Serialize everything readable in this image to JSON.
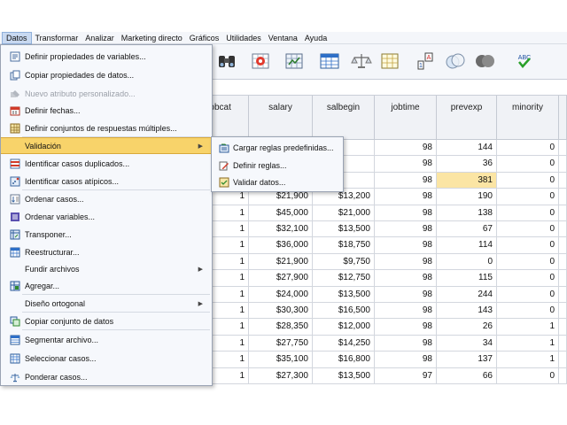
{
  "menubar": {
    "items": [
      {
        "label": "Datos",
        "active": true
      },
      {
        "label": "Transformar"
      },
      {
        "label": "Analizar"
      },
      {
        "label": "Marketing directo"
      },
      {
        "label": "Gráficos"
      },
      {
        "label": "Utilidades"
      },
      {
        "label": "Ventana"
      },
      {
        "label": "Ayuda"
      }
    ]
  },
  "toolbar": {
    "icons": [
      "binoculars-icon",
      "go-to-case-icon",
      "go-to-variable-icon",
      "split-file-icon",
      "weight-cases-icon",
      "select-cases-icon",
      "value-labels-icon",
      "use-sets-icon",
      "show-all-variables-icon",
      "spell-check-icon"
    ],
    "spellcheck_label": "ABC"
  },
  "grid": {
    "columns": [
      "jobcat",
      "salary",
      "salbegin",
      "jobtime",
      "prevexp",
      "minority"
    ],
    "rows": [
      {
        "jobcat": "",
        "salary": "",
        "salbegin": "",
        "jobtime": "98",
        "prevexp": "144",
        "minority": "0"
      },
      {
        "jobcat": "",
        "salary": "",
        "salbegin": "",
        "jobtime": "98",
        "prevexp": "36",
        "minority": "0"
      },
      {
        "jobcat": "",
        "salary": "",
        "salbegin": "",
        "jobtime": "98",
        "prevexp": "381",
        "minority": "0"
      },
      {
        "jobcat": "1",
        "salary": "$21,900",
        "salbegin": "$13,200",
        "jobtime": "98",
        "prevexp": "190",
        "minority": "0"
      },
      {
        "jobcat": "1",
        "salary": "$45,000",
        "salbegin": "$21,000",
        "jobtime": "98",
        "prevexp": "138",
        "minority": "0"
      },
      {
        "jobcat": "1",
        "salary": "$32,100",
        "salbegin": "$13,500",
        "jobtime": "98",
        "prevexp": "67",
        "minority": "0"
      },
      {
        "jobcat": "1",
        "salary": "$36,000",
        "salbegin": "$18,750",
        "jobtime": "98",
        "prevexp": "114",
        "minority": "0"
      },
      {
        "jobcat": "1",
        "salary": "$21,900",
        "salbegin": "$9,750",
        "jobtime": "98",
        "prevexp": "0",
        "minority": "0"
      },
      {
        "jobcat": "1",
        "salary": "$27,900",
        "salbegin": "$12,750",
        "jobtime": "98",
        "prevexp": "115",
        "minority": "0"
      },
      {
        "jobcat": "1",
        "salary": "$24,000",
        "salbegin": "$13,500",
        "jobtime": "98",
        "prevexp": "244",
        "minority": "0"
      },
      {
        "jobcat": "1",
        "salary": "$30,300",
        "salbegin": "$16,500",
        "jobtime": "98",
        "prevexp": "143",
        "minority": "0"
      },
      {
        "jobcat": "1",
        "salary": "$28,350",
        "salbegin": "$12,000",
        "jobtime": "98",
        "prevexp": "26",
        "minority": "1"
      },
      {
        "jobcat": "1",
        "salary": "$27,750",
        "salbegin": "$14,250",
        "jobtime": "98",
        "prevexp": "34",
        "minority": "1"
      },
      {
        "jobcat": "1",
        "salary": "$35,100",
        "salbegin": "$16,800",
        "jobtime": "98",
        "prevexp": "137",
        "minority": "1"
      },
      {
        "jobcat": "1",
        "salary": "$27,300",
        "salbegin": "$13,500",
        "jobtime": "97",
        "prevexp": "66",
        "minority": "0"
      }
    ],
    "highlight_color": "#fbe5a4"
  },
  "data_menu": {
    "items": [
      {
        "label": "Definir propiedades de variables...",
        "icon": "define-properties-icon"
      },
      {
        "label": "Copiar propiedades de datos...",
        "icon": "copy-properties-icon"
      },
      {
        "label": "Nuevo atributo personalizado...",
        "icon": "custom-attribute-icon",
        "disabled": true
      },
      {
        "label": "Definir fechas...",
        "icon": "calendar-icon"
      },
      {
        "label": "Definir conjuntos de respuestas múltiples...",
        "icon": "multiple-response-icon"
      },
      {
        "label": "Validación",
        "submenu": true,
        "selected": true
      },
      {
        "label": "Identificar casos duplicados...",
        "icon": "duplicate-cases-icon"
      },
      {
        "label": "Identificar casos atípicos...",
        "icon": "unusual-cases-icon"
      },
      {
        "label": "Ordenar casos...",
        "icon": "sort-cases-icon"
      },
      {
        "label": "Ordenar variables...",
        "icon": "sort-variables-icon"
      },
      {
        "label": "Transponer...",
        "icon": "transpose-icon"
      },
      {
        "label": "Reestructurar...",
        "icon": "restructure-icon"
      },
      {
        "label": "Fundir archivos",
        "submenu": true
      },
      {
        "label": "Agregar...",
        "icon": "aggregate-icon"
      },
      {
        "label": "Diseño ortogonal",
        "submenu": true
      },
      {
        "label": "Copiar conjunto de datos",
        "icon": "copy-dataset-icon"
      },
      {
        "label": "Segmentar archivo...",
        "icon": "split-file-icon"
      },
      {
        "label": "Seleccionar casos...",
        "icon": "select-cases-icon"
      },
      {
        "label": "Ponderar casos...",
        "icon": "weight-cases-icon"
      }
    ]
  },
  "validation_submenu": {
    "items": [
      {
        "label": "Cargar reglas predefinidas...",
        "icon": "load-rules-icon"
      },
      {
        "label": "Definir reglas...",
        "icon": "define-rules-icon"
      },
      {
        "label": "Validar datos...",
        "icon": "validate-data-icon"
      }
    ]
  },
  "colors": {
    "menu_selected": "#f8d36a",
    "menubar_active": "#c8d9f1"
  }
}
